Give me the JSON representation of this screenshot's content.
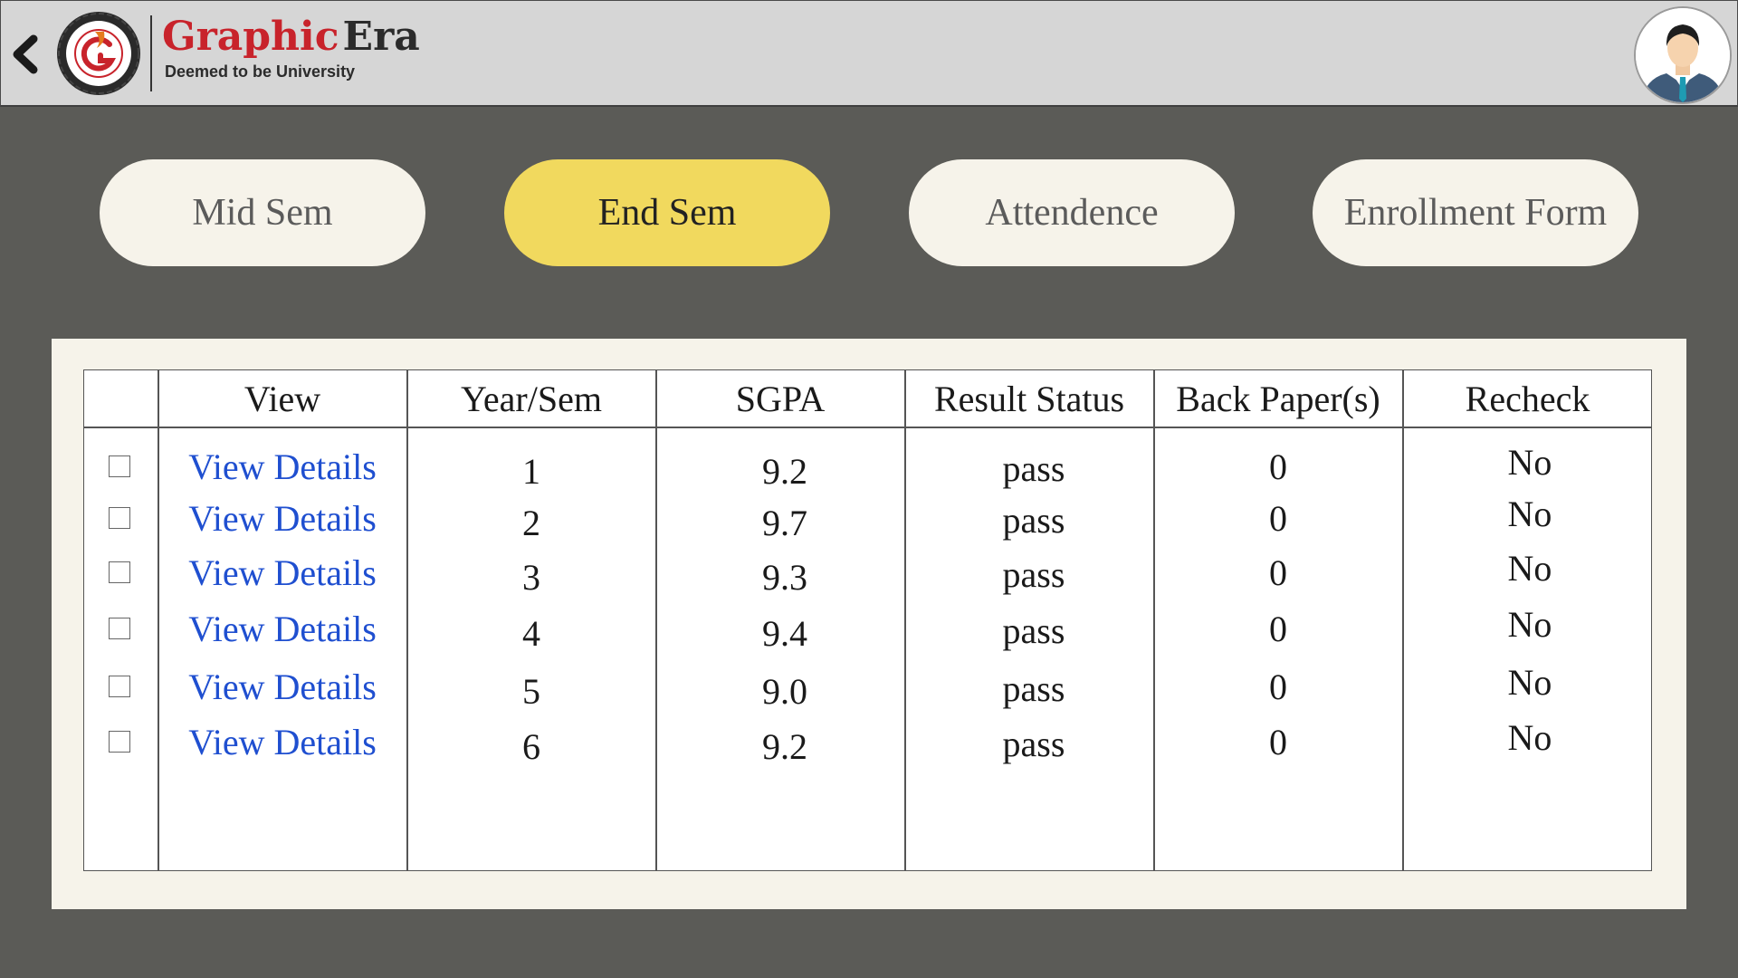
{
  "header": {
    "logo_word_1": "Graphic",
    "logo_word_2": "Era",
    "logo_tagline": "Deemed to be University",
    "seal_text": "GRAPHIC ERA"
  },
  "tabs": [
    {
      "label": "Mid Sem",
      "active": false
    },
    {
      "label": "End Sem",
      "active": true
    },
    {
      "label": "Attendence",
      "active": false
    },
    {
      "label": "Enrollment Form",
      "active": false
    }
  ],
  "colors": {
    "background": "#5b5b57",
    "header": "#d6d6d6",
    "tab_active": "#f1d95e",
    "tab_inactive": "#f6f3ea",
    "link": "#1f4fd0",
    "brand_red": "#c8232b"
  },
  "table": {
    "headers": [
      "",
      "View",
      "Year/Sem",
      "SGPA",
      "Result Status",
      "Back Paper(s)",
      "Recheck"
    ],
    "rows": [
      {
        "view": "View Details",
        "year_sem": "1",
        "sgpa": "9.2",
        "status": "pass",
        "back": "0",
        "recheck": "No"
      },
      {
        "view": "View Details",
        "year_sem": "2",
        "sgpa": "9.7",
        "status": "pass",
        "back": "0",
        "recheck": "No"
      },
      {
        "view": "View Details",
        "year_sem": "3",
        "sgpa": "9.3",
        "status": "pass",
        "back": "0",
        "recheck": "No"
      },
      {
        "view": "View Details",
        "year_sem": "4",
        "sgpa": "9.4",
        "status": "pass",
        "back": "0",
        "recheck": "No"
      },
      {
        "view": "View Details",
        "year_sem": "5",
        "sgpa": "9.0",
        "status": "pass",
        "back": "0",
        "recheck": "No"
      },
      {
        "view": "View Details",
        "year_sem": "6",
        "sgpa": "9.2",
        "status": "pass",
        "back": "0",
        "recheck": "No"
      }
    ]
  },
  "icons": {
    "back": "chevron-left-icon",
    "avatar": "user-avatar-icon",
    "logo": "graphic-era-seal-icon"
  }
}
